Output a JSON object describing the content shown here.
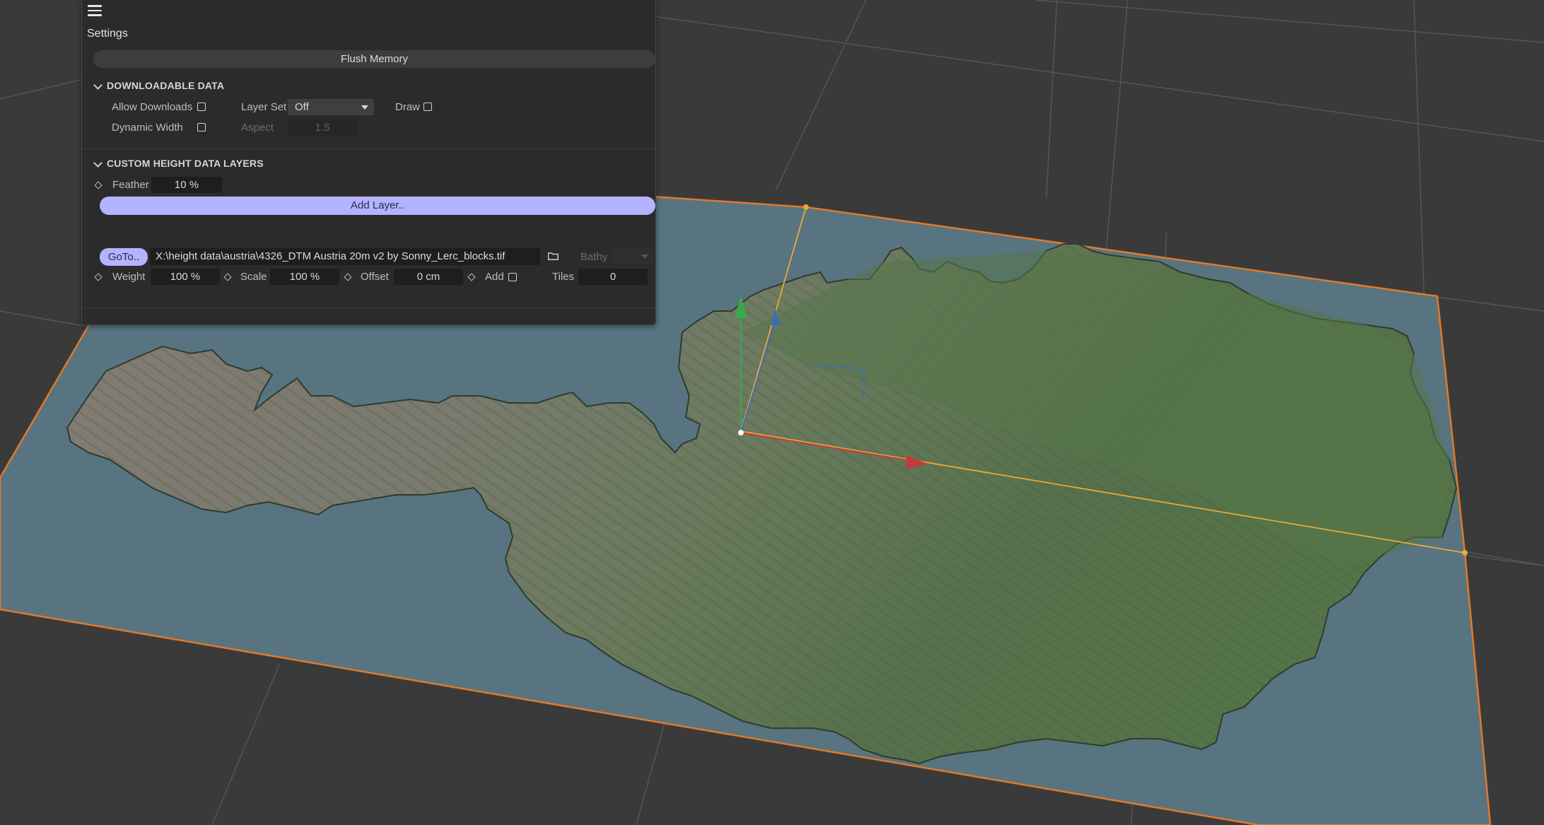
{
  "panel": {
    "title": "Settings",
    "flush_label": "Flush Memory",
    "downloadable": {
      "heading": "DOWNLOADABLE DATA",
      "allow_downloads_label": "Allow Downloads",
      "allow_downloads_checked": false,
      "layer_set_label": "Layer Set",
      "layer_set_value": "Off",
      "draw_label": "Draw",
      "draw_checked": false,
      "dynamic_width_label": "Dynamic Width",
      "dynamic_width_checked": false,
      "aspect_label": "Aspect",
      "aspect_value": "1.5"
    },
    "custom_height": {
      "heading": "CUSTOM HEIGHT DATA LAYERS",
      "feather_label": "Feather",
      "feather_value": "10 %",
      "add_layer_label": "Add Layer..",
      "layer": {
        "goto_label": "GoTo..",
        "path": "X:\\height data\\austria\\4326_DTM Austria 20m v2 by Sonny_Lerc_blocks.tif",
        "bathy_label": "Bathy",
        "bathy_value": "",
        "weight_label": "Weight",
        "weight_value": "100 %",
        "scale_label": "Scale",
        "scale_value": "100 %",
        "offset_label": "Offset",
        "offset_value": "0 cm",
        "add_label": "Add",
        "add_checked": false,
        "tiles_label": "Tiles",
        "tiles_value": "0"
      }
    }
  },
  "colors": {
    "background": "#3a3a3a",
    "grid": "#545454",
    "plane": "#55707a",
    "plane_outline": "#e07a2a",
    "terrain_low": "#4f6d45",
    "terrain_high": "#8a7f78",
    "accent_button": "#b3b3ff",
    "axis_x": "#c23a3a",
    "axis_y": "#3aa84f",
    "axis_z": "#3d6bbd"
  }
}
